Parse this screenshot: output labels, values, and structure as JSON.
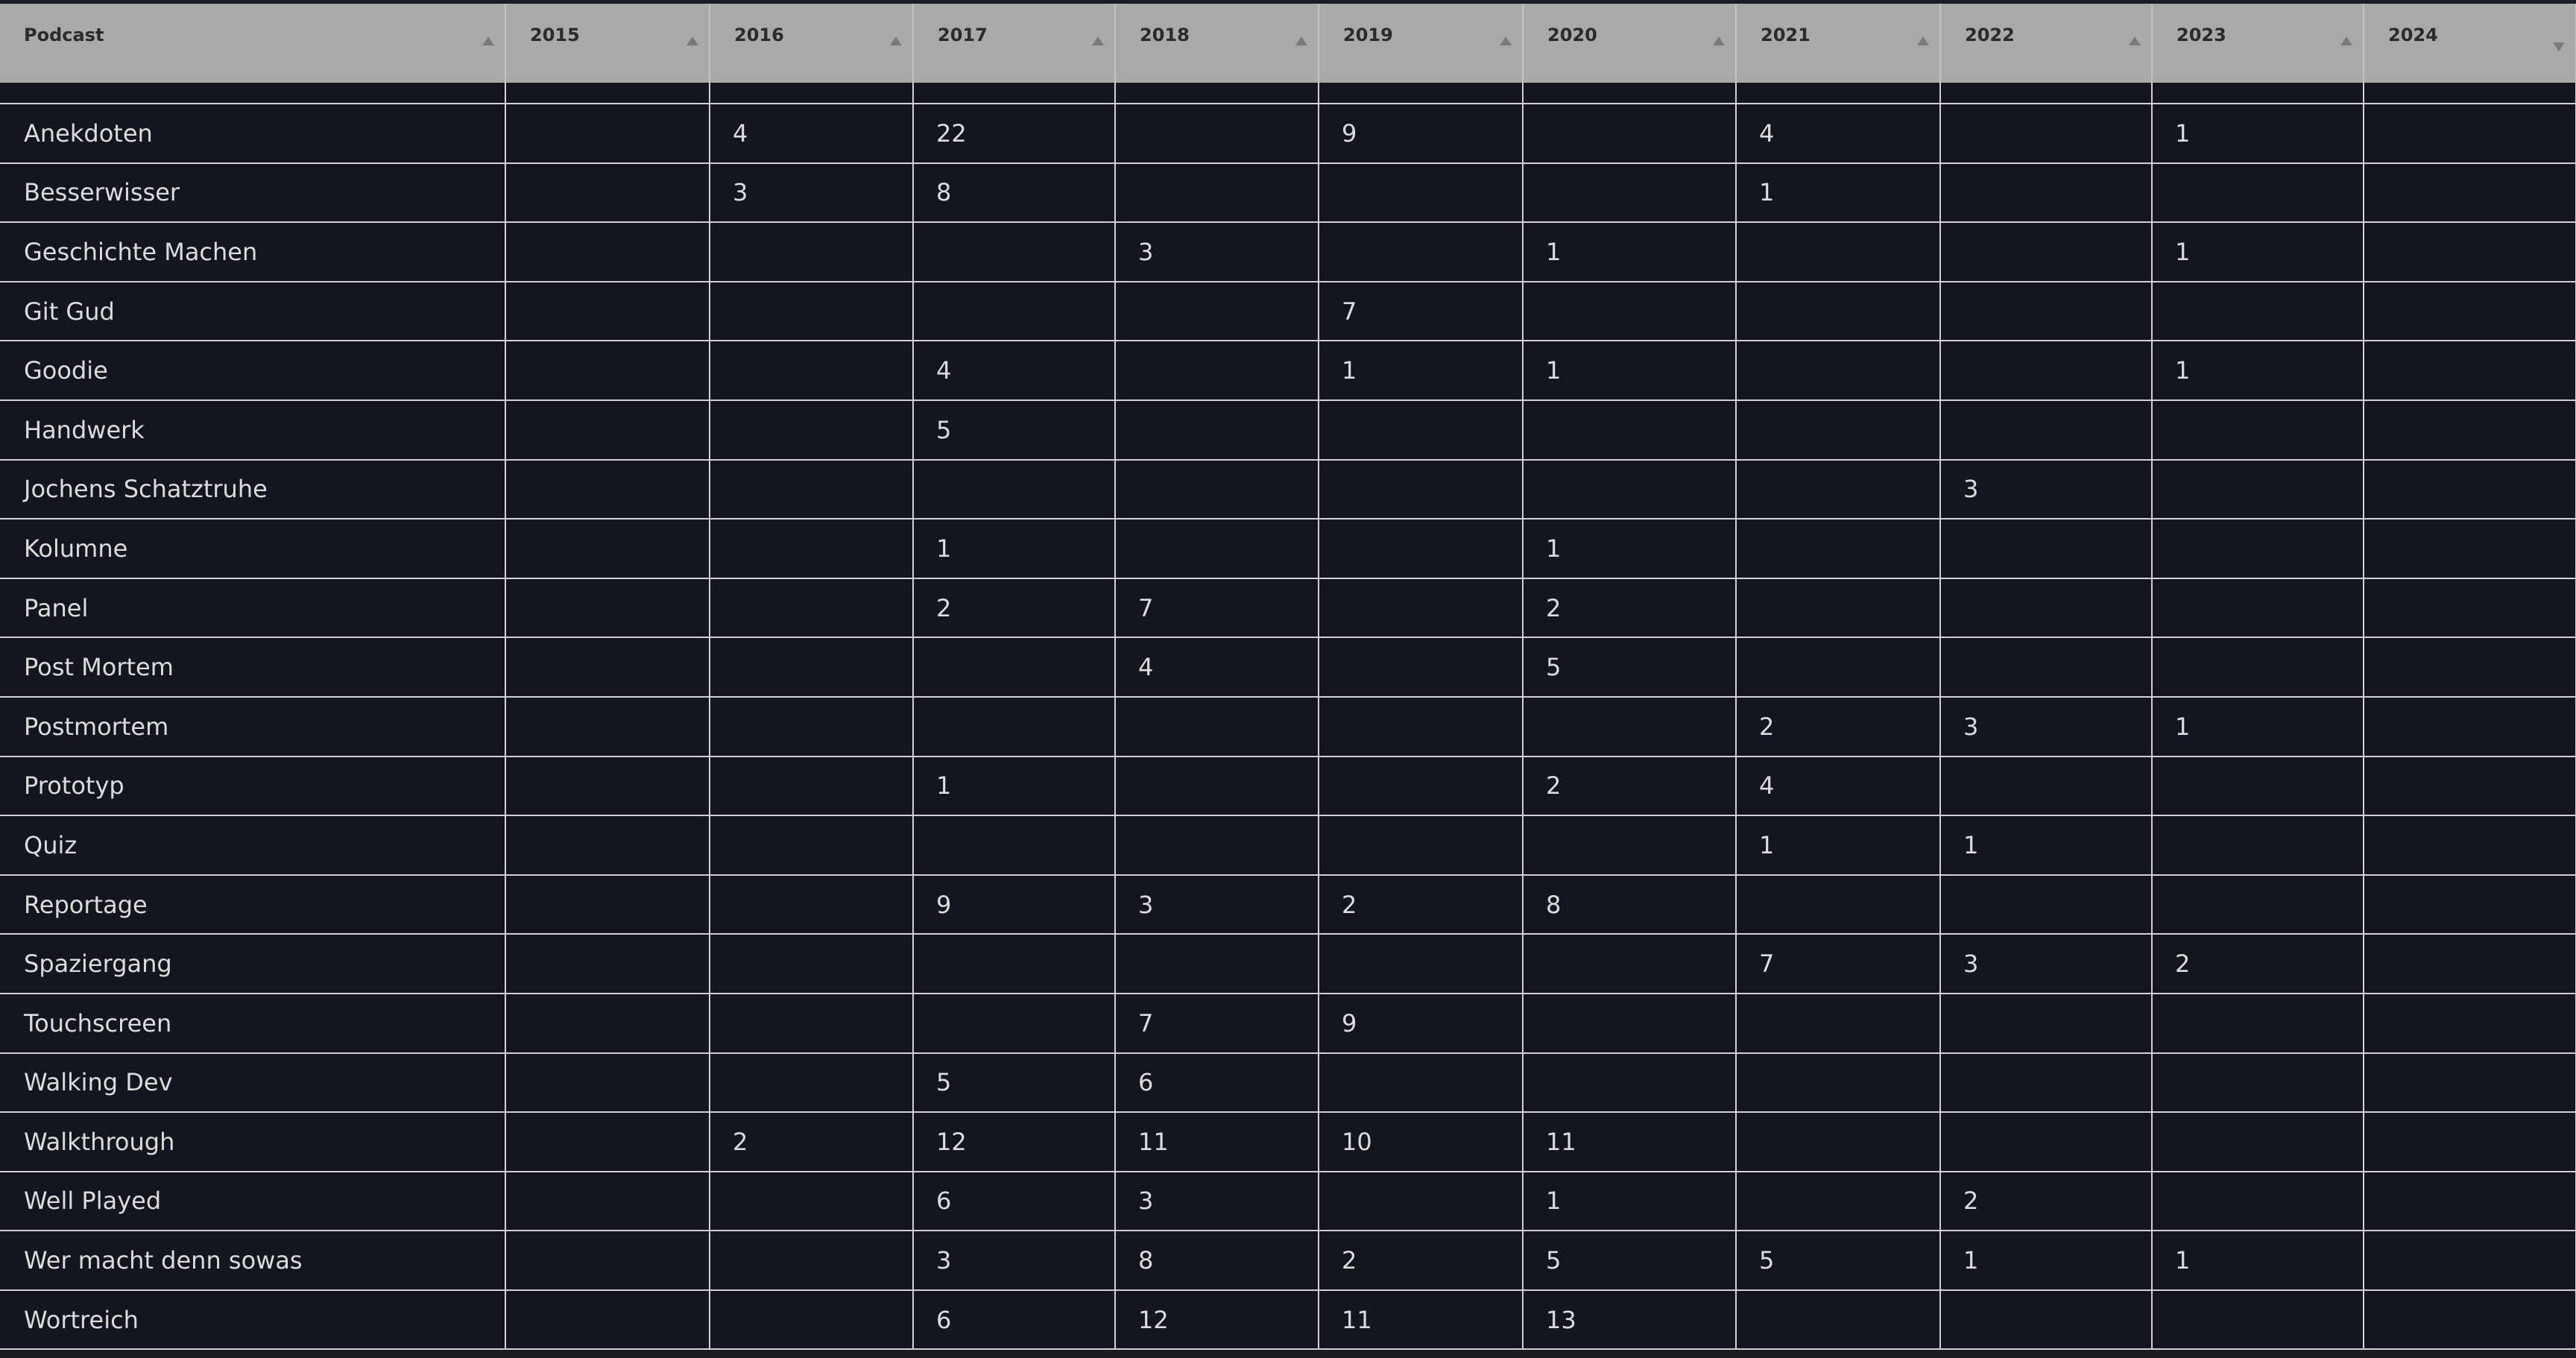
{
  "table": {
    "columns": [
      {
        "label": "Podcast",
        "sort": "up"
      },
      {
        "label": "2015",
        "sort": "up"
      },
      {
        "label": "2016",
        "sort": "up"
      },
      {
        "label": "2017",
        "sort": "up"
      },
      {
        "label": "2018",
        "sort": "up"
      },
      {
        "label": "2019",
        "sort": "up"
      },
      {
        "label": "2020",
        "sort": "up"
      },
      {
        "label": "2021",
        "sort": "up"
      },
      {
        "label": "2022",
        "sort": "up"
      },
      {
        "label": "2023",
        "sort": "up"
      },
      {
        "label": "2024",
        "sort": "down"
      }
    ],
    "rows": [
      [
        "Anekdoten",
        "",
        "4",
        "22",
        "",
        "9",
        "",
        "4",
        "",
        "1",
        ""
      ],
      [
        "Besserwisser",
        "",
        "3",
        "8",
        "",
        "",
        "",
        "1",
        "",
        "",
        ""
      ],
      [
        "Geschichte Machen",
        "",
        "",
        "",
        "3",
        "",
        "1",
        "",
        "",
        "1",
        ""
      ],
      [
        "Git Gud",
        "",
        "",
        "",
        "",
        "7",
        "",
        "",
        "",
        "",
        ""
      ],
      [
        "Goodie",
        "",
        "",
        "4",
        "",
        "1",
        "1",
        "",
        "",
        "1",
        ""
      ],
      [
        "Handwerk",
        "",
        "",
        "5",
        "",
        "",
        "",
        "",
        "",
        "",
        ""
      ],
      [
        "Jochens Schatztruhe",
        "",
        "",
        "",
        "",
        "",
        "",
        "",
        "3",
        "",
        ""
      ],
      [
        "Kolumne",
        "",
        "",
        "1",
        "",
        "",
        "1",
        "",
        "",
        "",
        ""
      ],
      [
        "Panel",
        "",
        "",
        "2",
        "7",
        "",
        "2",
        "",
        "",
        "",
        ""
      ],
      [
        "Post Mortem",
        "",
        "",
        "",
        "4",
        "",
        "5",
        "",
        "",
        "",
        ""
      ],
      [
        "Postmortem",
        "",
        "",
        "",
        "",
        "",
        "",
        "2",
        "3",
        "1",
        ""
      ],
      [
        "Prototyp",
        "",
        "",
        "1",
        "",
        "",
        "2",
        "4",
        "",
        "",
        ""
      ],
      [
        "Quiz",
        "",
        "",
        "",
        "",
        "",
        "",
        "1",
        "1",
        "",
        ""
      ],
      [
        "Reportage",
        "",
        "",
        "9",
        "3",
        "2",
        "8",
        "",
        "",
        "",
        ""
      ],
      [
        "Spaziergang",
        "",
        "",
        "",
        "",
        "",
        "",
        "7",
        "3",
        "2",
        ""
      ],
      [
        "Touchscreen",
        "",
        "",
        "",
        "7",
        "9",
        "",
        "",
        "",
        "",
        ""
      ],
      [
        "Walking Dev",
        "",
        "",
        "5",
        "6",
        "",
        "",
        "",
        "",
        "",
        ""
      ],
      [
        "Walkthrough",
        "",
        "2",
        "12",
        "11",
        "10",
        "11",
        "",
        "",
        "",
        ""
      ],
      [
        "Well Played",
        "",
        "",
        "6",
        "3",
        "",
        "1",
        "",
        "2",
        "",
        ""
      ],
      [
        "Wer macht denn sowas",
        "",
        "",
        "3",
        "8",
        "2",
        "5",
        "5",
        "1",
        "1",
        ""
      ],
      [
        "Wortreich",
        "",
        "",
        "6",
        "12",
        "11",
        "13",
        "",
        "",
        "",
        ""
      ]
    ]
  },
  "colors": {
    "header_bg": "#a9a9a9",
    "body_bg": "#14161f",
    "grid": "#cfd1d6",
    "text": "#dcdcdc"
  }
}
